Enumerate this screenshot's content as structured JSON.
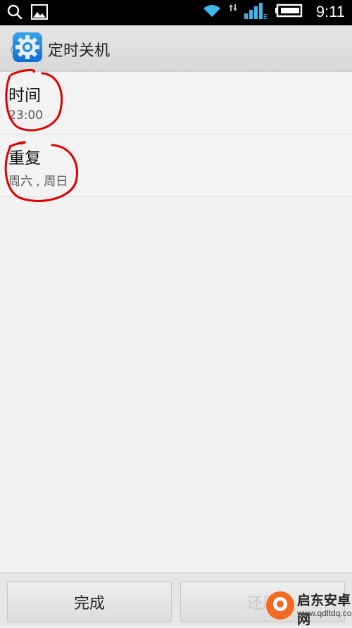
{
  "status_bar": {
    "time": "9:11",
    "network_type": "E",
    "icons": [
      "search-icon",
      "image-icon",
      "wifi-icon",
      "data-arrows-icon",
      "signal-icon",
      "battery-icon"
    ]
  },
  "header": {
    "back_glyph": "《",
    "title": "定时关机",
    "app_icon": "settings-gear-icon"
  },
  "settings": {
    "items": [
      {
        "title": "时间",
        "value": "23:00"
      },
      {
        "title": "重复",
        "value": "周六 , 周日"
      }
    ]
  },
  "footer": {
    "done_label": "完成",
    "restore_label": "还原"
  },
  "watermark": {
    "brand": "启东安卓网",
    "url": "www.qdltdq.com"
  },
  "colors": {
    "annotation": "#e00000",
    "app_icon_blue": "#1f86e3",
    "watermark_orange": "#f36b22"
  }
}
